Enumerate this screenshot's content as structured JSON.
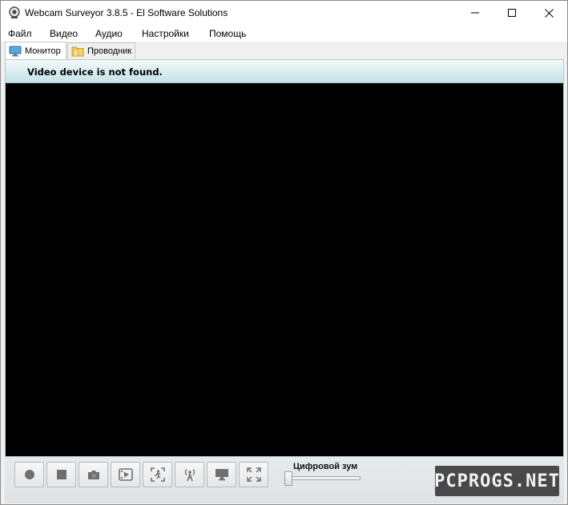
{
  "window": {
    "title": "Webcam Surveyor 3.8.5 - El Software Solutions",
    "minimize_icon": "minimize-icon",
    "maximize_icon": "maximize-icon",
    "close_icon": "close-icon"
  },
  "menu": {
    "items": [
      {
        "label": "Файл"
      },
      {
        "label": "Видео"
      },
      {
        "label": "Аудио"
      },
      {
        "label": "Настройки"
      },
      {
        "label": "Помощь"
      }
    ]
  },
  "tabs": [
    {
      "label": "Монитор",
      "icon": "monitor-icon",
      "active": true
    },
    {
      "label": "Проводник",
      "icon": "folder-icon",
      "active": false
    }
  ],
  "status": {
    "message": "Video device is not found."
  },
  "toolbar": {
    "buttons": [
      {
        "icon": "record-icon"
      },
      {
        "icon": "stop-icon"
      },
      {
        "icon": "snapshot-icon"
      },
      {
        "icon": "play-video-icon"
      },
      {
        "icon": "motion-detect-icon"
      },
      {
        "icon": "broadcast-icon"
      },
      {
        "icon": "display-icon"
      },
      {
        "icon": "fullscreen-icon"
      }
    ],
    "zoom_label": "Цифровой зум",
    "zoom_level": 0
  },
  "watermark": {
    "text": "PCPROGS.NET"
  },
  "colors": {
    "status_bar": "#d4ecef",
    "video_background": "#000000",
    "toolbar": "#e2e6e9"
  }
}
